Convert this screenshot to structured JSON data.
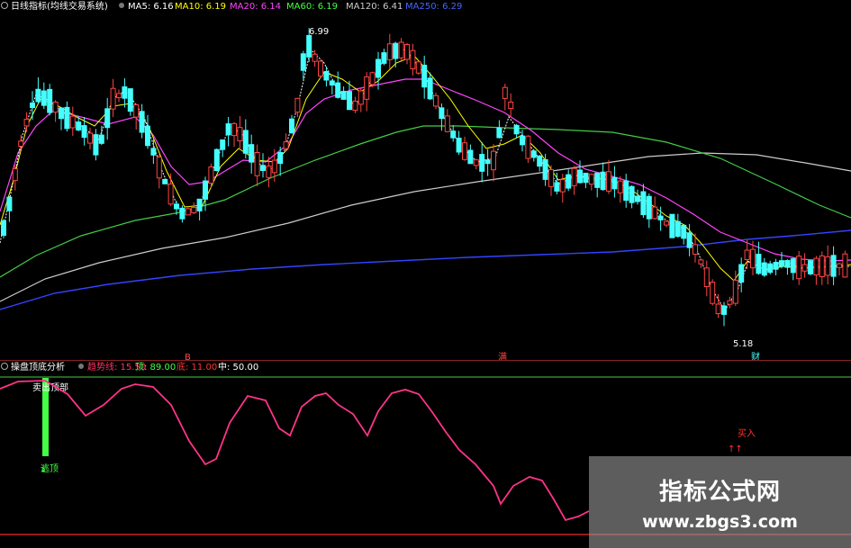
{
  "top_legend": {
    "indicator_name": "日线指标(均线交易系统)",
    "items": [
      {
        "label": "MA5: 6.16",
        "color": "#ffffff"
      },
      {
        "label": "MA10: 6.19",
        "color": "#ffff00"
      },
      {
        "label": "MA20: 6.14",
        "color": "#ff44ff"
      },
      {
        "label": "MA60: 6.19",
        "color": "#44ff44"
      },
      {
        "label": "MA120: 6.41",
        "color": "#cccccc"
      },
      {
        "label": "MA250: 6.29",
        "color": "#4466ff"
      }
    ]
  },
  "bottom_legend": {
    "indicator_name": "操盘顶底分析",
    "items": [
      {
        "label": "趋势线: 15.50",
        "color": "#ff3366"
      },
      {
        "label": "顶: 89.00",
        "color": "#44ff44"
      },
      {
        "label": "底: 11.00",
        "color": "#ff3333"
      },
      {
        "label": "中: 50.00",
        "color": "#ffffff"
      }
    ]
  },
  "annotations": {
    "high_price": "6.99",
    "low_price": "5.18",
    "sub_signal": "卖出顶部",
    "sell_text": "逃顶",
    "buy_text": "买入",
    "marker_left": "B",
    "marker_mid": "满",
    "marker_right": "财"
  },
  "watermark": {
    "title": "指标公式网",
    "url": "www.zbgs3.com"
  },
  "colors": {
    "up": "#ff4444",
    "down": "#44ffff",
    "ma5": "#ffffff",
    "ma10": "#ffff00",
    "ma20": "#ff44ff",
    "ma60": "#44cc44",
    "ma120": "#cccccc",
    "ma250": "#3344ff",
    "trend": "#ff3388"
  },
  "chart_data": [
    {
      "type": "candlestick",
      "title": "",
      "series": [
        {
          "name": "MA5",
          "value": 6.16
        },
        {
          "name": "MA10",
          "value": 6.19
        },
        {
          "name": "MA20",
          "value": 6.14
        },
        {
          "name": "MA60",
          "value": 6.19
        },
        {
          "name": "MA120",
          "value": 6.41
        },
        {
          "name": "MA250",
          "value": 6.29
        }
      ],
      "ylim": [
        5.1,
        7.05
      ],
      "annotations": [
        {
          "text": "6.99",
          "kind": "high"
        },
        {
          "text": "5.18",
          "kind": "low"
        }
      ]
    },
    {
      "type": "line",
      "title": "",
      "series": [
        {
          "name": "趋势线",
          "last_value": 15.5
        }
      ],
      "reference_lines": {
        "top": 89.0,
        "bottom": 11.0,
        "mid": 50.0
      },
      "ylim": [
        0,
        100
      ]
    }
  ]
}
